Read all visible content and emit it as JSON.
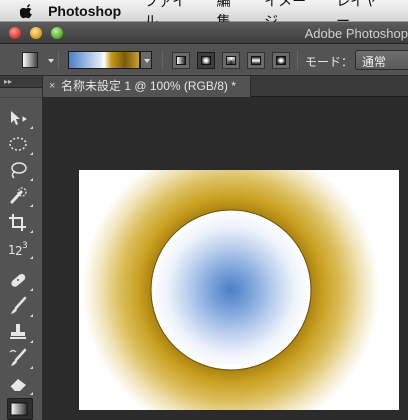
{
  "menubar": {
    "app_name": "Photoshop",
    "items": [
      "ファイル",
      "編集",
      "イメージ",
      "レイヤー"
    ]
  },
  "window": {
    "title": "Adobe Photoshop"
  },
  "options_bar": {
    "mode_label": "モード：",
    "mode_value": "通常",
    "gradient_types": [
      "linear",
      "radial",
      "angle",
      "reflected",
      "diamond"
    ],
    "active_gradient_type": "radial"
  },
  "document": {
    "tab_close": "×",
    "tab_title": "名称未設定 1 @ 100% (RGB/8) *"
  },
  "tools": {
    "header": "▸▸",
    "items": [
      "move-tool",
      "marquee-tool",
      "lasso-tool",
      "quick-selection-tool",
      "crop-tool",
      "count-tool",
      "healing-brush-tool",
      "brush-tool",
      "clone-stamp-tool",
      "history-brush-tool",
      "eraser-tool",
      "gradient-tool"
    ],
    "active": "gradient-tool"
  },
  "colors": {
    "gradient_center": "#4a7fc8",
    "gradient_ring": "#7a5a0c",
    "gradient_gold": "#c9a030",
    "canvas_bg": "#ffffff"
  }
}
